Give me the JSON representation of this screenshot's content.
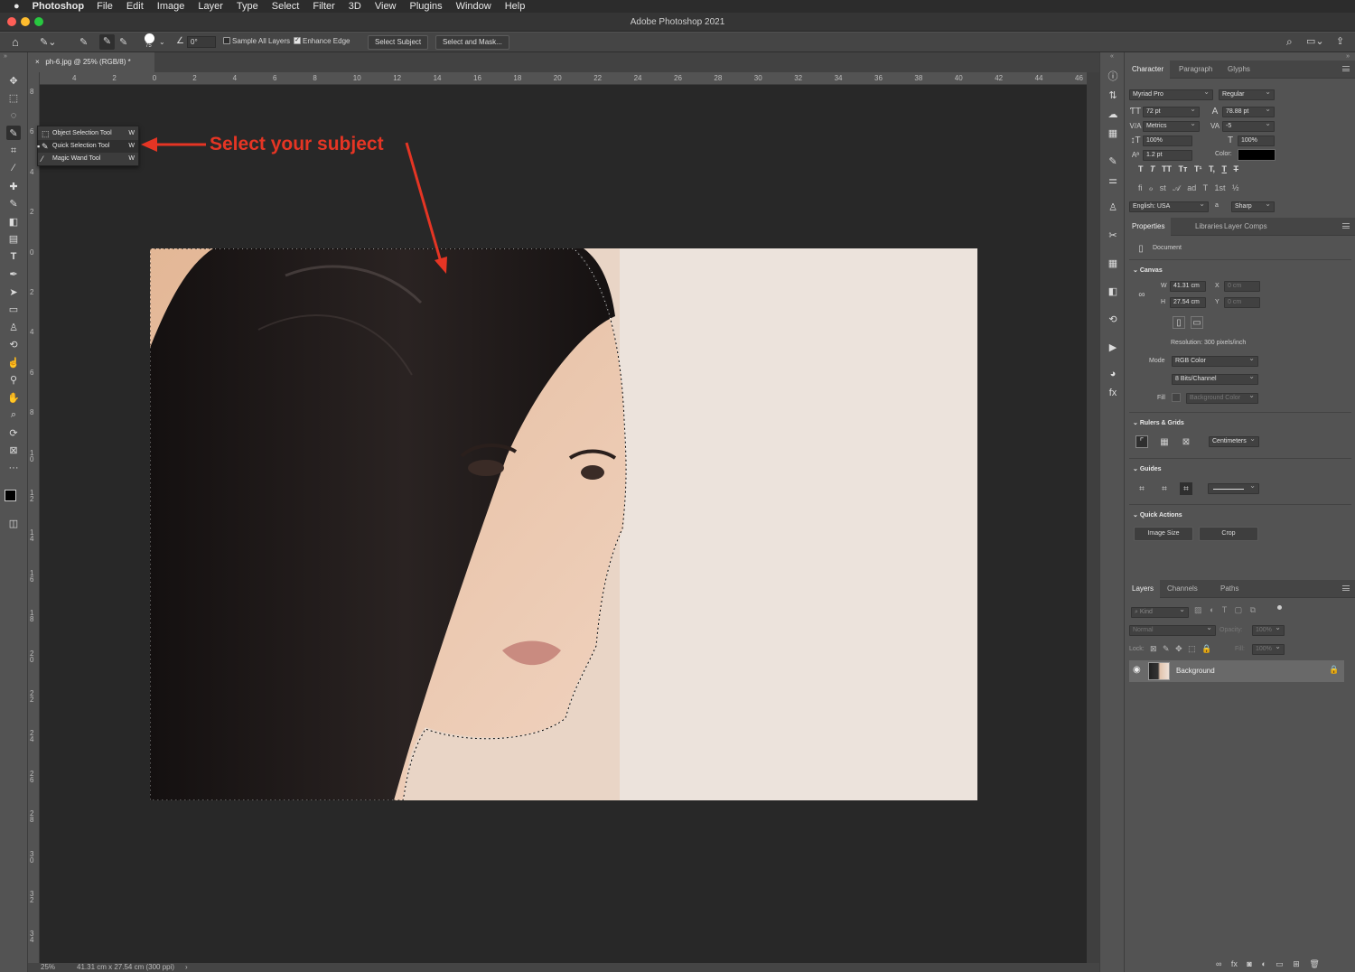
{
  "menubar": {
    "apple": "",
    "app": "Photoshop",
    "items": [
      "File",
      "Edit",
      "Image",
      "Layer",
      "Type",
      "Select",
      "Filter",
      "3D",
      "View",
      "Plugins",
      "Window",
      "Help"
    ]
  },
  "window": {
    "title": "Adobe Photoshop 2021"
  },
  "options": {
    "angle": "0°",
    "brush_size": "75",
    "sample_all_layers": "Sample All Layers",
    "enhance_edge": "Enhance Edge",
    "select_subject": "Select Subject",
    "select_and_mask": "Select and Mask..."
  },
  "document": {
    "tab": "ph-6.jpg @ 25% (RGB/8) *"
  },
  "ruler_h": [
    "4",
    "2",
    "0",
    "2",
    "4",
    "6",
    "8",
    "10",
    "12",
    "14",
    "16",
    "18",
    "20",
    "22",
    "24",
    "26",
    "28",
    "30",
    "32",
    "34",
    "36",
    "38",
    "40",
    "42",
    "44",
    "46"
  ],
  "ruler_v": [
    "8",
    "6",
    "4",
    "2",
    "0",
    "2",
    "4",
    "6",
    "8",
    "1\n0",
    "1\n2",
    "1\n4",
    "1\n6",
    "1\n8",
    "2\n0",
    "2\n2",
    "2\n4",
    "2\n6",
    "2\n8",
    "3\n0",
    "3\n2",
    "3\n4"
  ],
  "flyout": [
    {
      "label": "Object Selection Tool",
      "key": "W"
    },
    {
      "label": "Quick Selection Tool",
      "key": "W"
    },
    {
      "label": "Magic Wand Tool",
      "key": "W"
    }
  ],
  "annotation": "Select your subject",
  "status": {
    "zoom": "25%",
    "dims": "41.31 cm x 27.54 cm (300 ppi)"
  },
  "character": {
    "tabs": [
      "Character",
      "Paragraph",
      "Glyphs"
    ],
    "font": "Myriad Pro",
    "style": "Regular",
    "size": "72 pt",
    "leading": "78.88 pt",
    "kerning": "Metrics",
    "tracking": "-5",
    "vscale": "100%",
    "hscale": "100%",
    "baseline": "1.2 pt",
    "color_label": "Color:",
    "language": "English: USA",
    "aa_label": "a",
    "antialias": "Sharp",
    "type_buttons": [
      "T",
      "T",
      "TT",
      "Tт",
      "T¹",
      "T,",
      "T",
      "T"
    ],
    "ot_buttons": [
      "fi",
      "ℴ",
      "st",
      "𝒜",
      "ad",
      "T",
      "1st",
      "½"
    ]
  },
  "properties": {
    "tabs": [
      "Properties",
      "Libraries",
      "Layer Comps"
    ],
    "kind": "Document",
    "canvas_title": "Canvas",
    "w_label": "W",
    "w": "41.31 cm",
    "h_label": "H",
    "h": "27.54 cm",
    "x_label": "X",
    "x": "0 cm",
    "y_label": "Y",
    "y": "0 cm",
    "resolution": "Resolution: 300 pixels/inch",
    "mode_label": "Mode",
    "mode": "RGB Color",
    "depth": "8 Bits/Channel",
    "fill_label": "Fill",
    "fill": "Background Color",
    "rulers_title": "Rulers & Grids",
    "units": "Centimeters",
    "guides_title": "Guides",
    "quick_title": "Quick Actions",
    "image_size": "Image Size",
    "crop": "Crop"
  },
  "layers": {
    "tabs": [
      "Layers",
      "Channels",
      "Paths"
    ],
    "kind": "Kind",
    "blend": "Normal",
    "opacity_label": "Opacity:",
    "opacity": "100%",
    "lock_label": "Lock:",
    "fill_label": "Fill:",
    "fill": "100%",
    "items": [
      {
        "name": "Background"
      }
    ]
  },
  "colors": {
    "accent": "#e53524",
    "bg": "#282828",
    "panel": "#535353"
  }
}
